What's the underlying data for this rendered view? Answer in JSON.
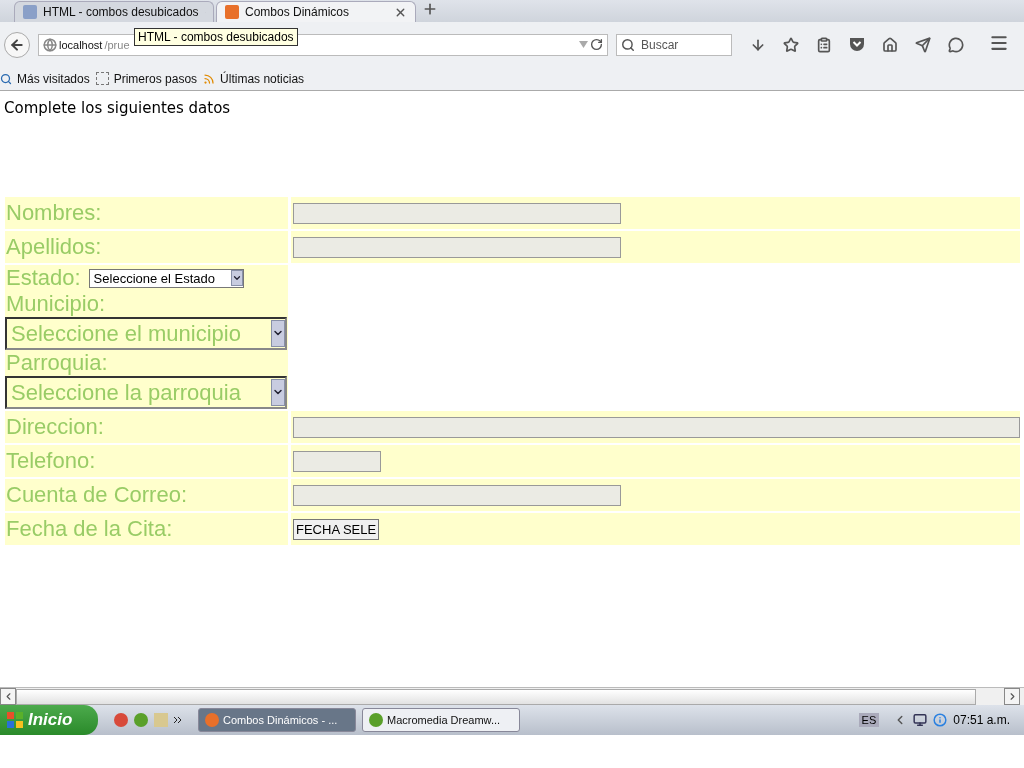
{
  "browser": {
    "tabs": [
      {
        "title": "HTML - combos desubicados",
        "selected": false
      },
      {
        "title": "Combos Dinámicos",
        "selected": true
      }
    ],
    "url": {
      "host": "localhost",
      "path": "/prue"
    },
    "tooltip": "HTML - combos desubicados",
    "search": {
      "placeholder": "Buscar"
    },
    "bookmarks": [
      "Más visitados",
      "Primeros pasos",
      "Últimas noticias"
    ]
  },
  "page": {
    "heading": "Complete los siguientes datos",
    "rows": [
      {
        "kind": "field",
        "label": "Nombres:"
      },
      {
        "kind": "field",
        "label": "Apellidos:"
      },
      {
        "kind": "selects",
        "items": [
          {
            "kind": "inline",
            "label": "Estado:",
            "value": "Seleccione el Estado"
          },
          {
            "kind": "stacked",
            "label": "Municipio:",
            "value": "Seleccione el municipio"
          },
          {
            "kind": "stacked",
            "label": "Parroquia:",
            "value": "Seleccione la parroquia"
          }
        ]
      },
      {
        "kind": "wide-field",
        "label": "Direccion:"
      },
      {
        "kind": "short-field",
        "label": "Telefono:"
      },
      {
        "kind": "field",
        "label": "Cuenta de Correo:"
      },
      {
        "kind": "button",
        "label": "Fecha de la Cita:",
        "button": "FECHA SELE"
      }
    ]
  },
  "taskbar": {
    "start": "Inicio",
    "tasks": [
      {
        "title": "Combos Dinámicos - ...",
        "selected": true
      },
      {
        "title": "Macromedia Dreamw...",
        "selected": false
      }
    ],
    "language": "ES",
    "clock": "07:51 a.m."
  }
}
